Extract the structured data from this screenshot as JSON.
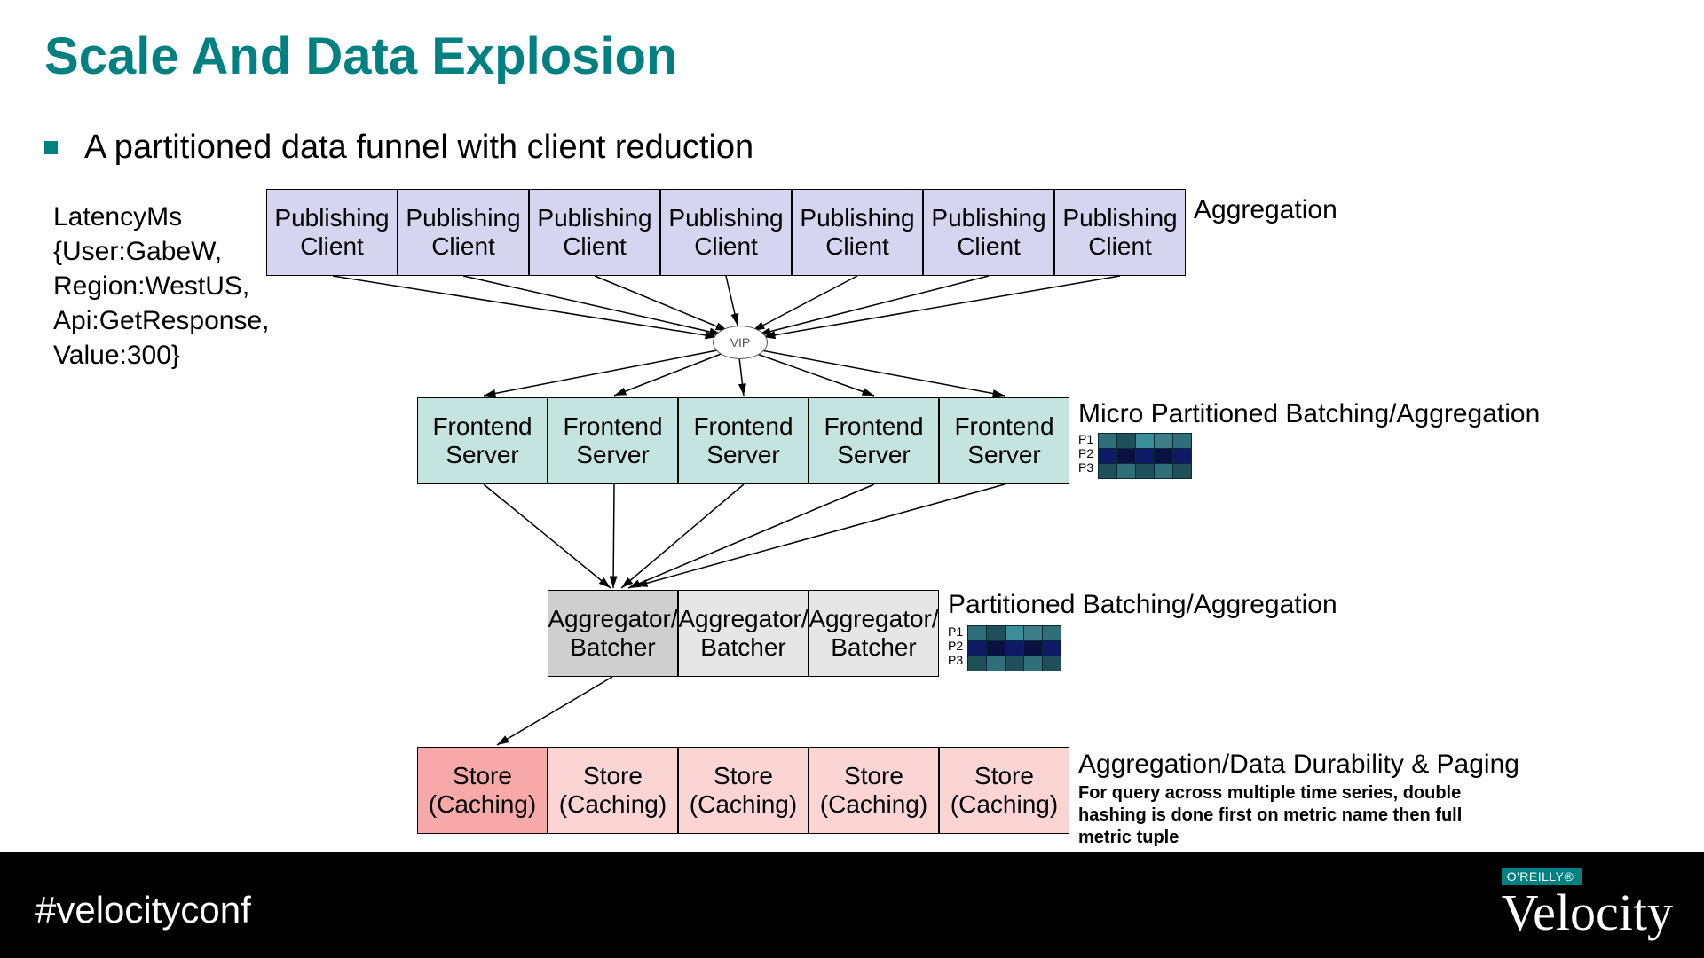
{
  "title": "Scale And Data Explosion",
  "bullet": "A partitioned data funnel with client reduction",
  "side_text": {
    "l1": "LatencyMs",
    "l2": "{User:GabeW,",
    "l3": "Region:WestUS,",
    "l4": "Api:GetResponse,",
    "l5": "Value:300}"
  },
  "vip": "VIP",
  "rows": {
    "publishing": {
      "label_top": "Publishing",
      "label_bot": "Client",
      "right": "Aggregation"
    },
    "frontend": {
      "label_top": "Frontend",
      "label_bot": "Server",
      "right": "Micro Partitioned Batching/Aggregation"
    },
    "aggregator": {
      "label_top": "Aggregator/",
      "label_bot": "Batcher",
      "right": "Partitioned Batching/Aggregation"
    },
    "store": {
      "label_top": "Store",
      "label_bot": "(Caching)",
      "right": "Aggregation/Data Durability & Paging",
      "note": "For query across multiple time series, double hashing is done first on metric name then full metric tuple"
    }
  },
  "pgrid_labels": {
    "p1": "P1",
    "p2": "P2",
    "p3": "P3"
  },
  "footer": {
    "hashtag": "#velocityconf",
    "brand_bar": "O'REILLY®",
    "brand_name": "Velocity"
  }
}
